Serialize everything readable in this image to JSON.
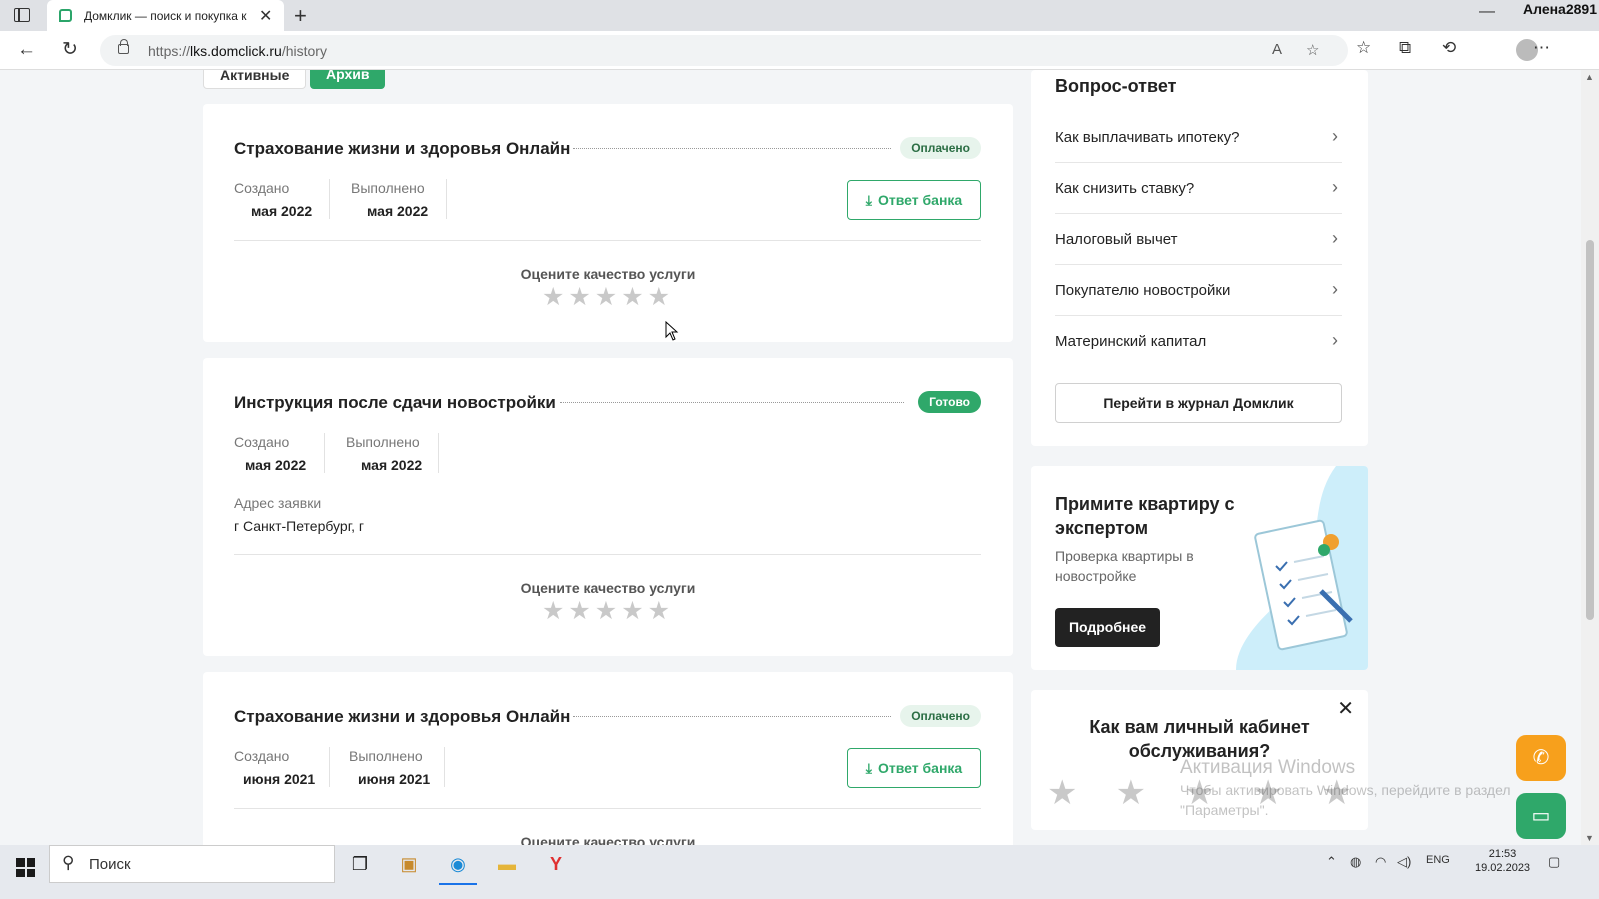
{
  "browser": {
    "tab_title": "Домклик — поиск и покупка к",
    "url_prefix": "https://",
    "url_host": "lks.domclick.ru",
    "url_path": "/history",
    "user_name": "Алена2891"
  },
  "filters": {
    "active": "Активные",
    "archive": "Архив"
  },
  "history_cards": [
    {
      "title": "Страхование жизни и здоровья Онлайн",
      "status": "Оплачено",
      "created_label": "Создано",
      "created_value": "мая 2022",
      "done_label": "Выполнено",
      "done_value": "мая 2022",
      "bank_button": "Ответ банка",
      "rate_label": "Оцените качество услуги"
    },
    {
      "title": "Инструкция после сдачи новостройки",
      "status": "Готово",
      "created_label": "Создано",
      "created_value": "мая 2022",
      "done_label": "Выполнено",
      "done_value": "мая 2022",
      "address_label": "Адрес заявки",
      "address_value": "г Санкт-Петербург, г",
      "rate_label": "Оцените качество услуги"
    },
    {
      "title": "Страхование жизни и здоровья Онлайн",
      "status": "Оплачено",
      "created_label": "Создано",
      "created_value": "июня 2021",
      "done_label": "Выполнено",
      "done_value": "июня 2021",
      "bank_button": "Ответ банка",
      "rate_label": "Оцените качество услуги"
    }
  ],
  "faq": {
    "title": "Вопрос-ответ",
    "items": [
      "Как выплачивать ипотеку?",
      "Как снизить ставку?",
      "Налоговый вычет",
      "Покупателю новостройки",
      "Материнский капитал"
    ],
    "journal_button": "Перейти в журнал Домклик"
  },
  "promo": {
    "title": "Примите квартиру с экспертом",
    "subtitle": "Проверка квартиры в новостройке",
    "button": "Подробнее"
  },
  "survey": {
    "title": "Как вам личный кабинет обслуживания?"
  },
  "watermark": {
    "title": "Активация Windows",
    "line1": "Чтобы активировать Windows, перейдите в раздел",
    "line2": "\"Параметры\"."
  },
  "taskbar": {
    "search_placeholder": "Поиск",
    "lang": "ENG",
    "time": "21:53",
    "date": "19.02.2023"
  },
  "colors": {
    "brand_green": "#2fa86a",
    "call_orange": "#f7a01c"
  }
}
